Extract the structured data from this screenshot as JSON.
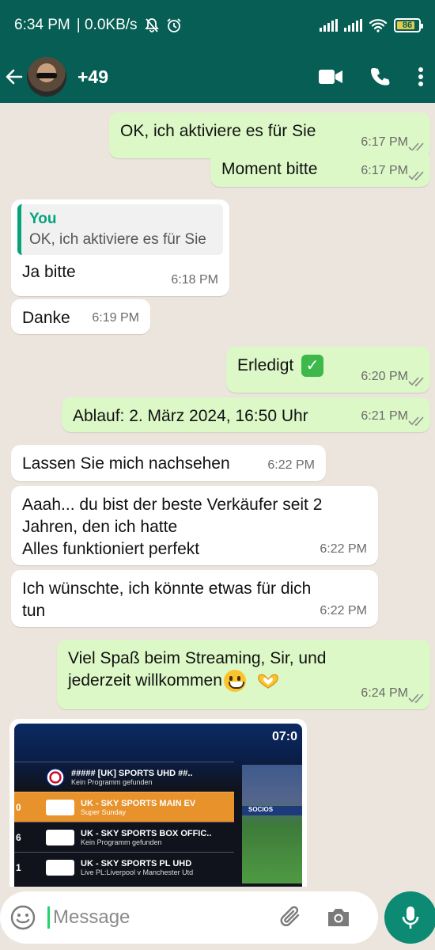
{
  "status_bar": {
    "time": "6:34 PM",
    "net": "| 0.0KB/s",
    "battery": "86"
  },
  "header": {
    "contact": "+49"
  },
  "messages": [
    {
      "dir": "out",
      "text": "OK, ich aktiviere es für Sie",
      "time": "6:17 PM"
    },
    {
      "dir": "out",
      "text": "Moment bitte",
      "time": "6:17 PM"
    },
    {
      "dir": "in",
      "quote_author": "You",
      "quote_text": "OK, ich aktiviere es für Sie",
      "text": "Ja bitte",
      "time": "6:18 PM"
    },
    {
      "dir": "in",
      "text": "Danke",
      "time": "6:19 PM"
    },
    {
      "dir": "out",
      "text": "Erledigt",
      "time": "6:20 PM"
    },
    {
      "dir": "out",
      "text": "Ablauf: 2. März 2024, 16:50 Uhr",
      "time": "6:21 PM"
    },
    {
      "dir": "in",
      "text": "Lassen Sie mich nachsehen",
      "time": "6:22 PM"
    },
    {
      "dir": "in",
      "lines": [
        "Aaah... du bist der beste Verkäufer seit 2",
        "Jahren, den ich hatte",
        "Alles funktioniert perfekt"
      ],
      "time": "6:22 PM"
    },
    {
      "dir": "in",
      "lines": [
        "Ich wünschte, ich könnte etwas für dich",
        "tun"
      ],
      "time": "6:22 PM"
    },
    {
      "dir": "out",
      "lines": [
        "Viel Spaß beim Streaming, Sir, und",
        "jederzeit willkommen"
      ],
      "time": "6:24 PM"
    }
  ],
  "image_message": {
    "tv_time": "07:0",
    "rows": [
      {
        "num": "",
        "title": "##### [UK] SPORTS UHD ##..",
        "sub": "Kein Programm gefunden"
      },
      {
        "num": "0",
        "title": "UK - SKY SPORTS MAIN EV",
        "sub": "Super Sunday"
      },
      {
        "num": "6",
        "title": "UK - SKY SPORTS BOX OFFIC..",
        "sub": "Kein Programm gefunden"
      },
      {
        "num": "1",
        "title": "UK - SKY SPORTS PL UHD",
        "sub": "Live PL:Liverpool v Manchester Utd"
      }
    ],
    "banner": "SOCIOS"
  },
  "input": {
    "placeholder": "Message"
  },
  "colors": {
    "header": "#075E54",
    "outgoing": "#DCF8C6",
    "incoming": "#FFFFFF",
    "background": "#ECE5DD",
    "mic": "#0C8A73"
  }
}
